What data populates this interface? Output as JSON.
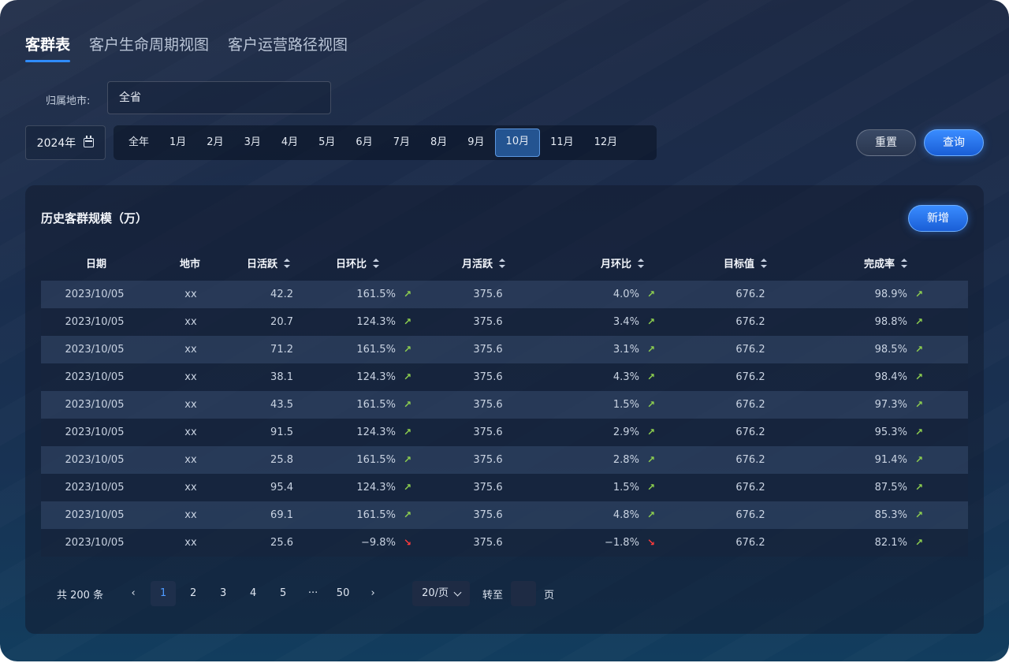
{
  "tabs": [
    {
      "label": "客群表",
      "active": true
    },
    {
      "label": "客户生命周期视图",
      "active": false
    },
    {
      "label": "客户运营路径视图",
      "active": false
    }
  ],
  "filter": {
    "city_label": "归属地市:",
    "city_value": "全省",
    "year_value": "2024年",
    "months": [
      "全年",
      "1月",
      "2月",
      "3月",
      "4月",
      "5月",
      "6月",
      "7月",
      "8月",
      "9月",
      "10月",
      "11月",
      "12月"
    ],
    "active_month": "10月",
    "reset_label": "重置",
    "query_label": "查询"
  },
  "card": {
    "title": "历史客群规模（万）",
    "add_label": "新增"
  },
  "table": {
    "headers": [
      "日期",
      "地市",
      "日活跃",
      "日环比",
      "月活跃",
      "月环比",
      "目标值",
      "完成率"
    ],
    "rows": [
      {
        "date": "2023/10/05",
        "city": "xx",
        "dau": "42.2",
        "dod": "161.5%",
        "dod_dir": "up",
        "mau": "375.6",
        "mom": "4.0%",
        "mom_dir": "up",
        "target": "676.2",
        "rate": "98.9%",
        "rate_dir": "up"
      },
      {
        "date": "2023/10/05",
        "city": "xx",
        "dau": "20.7",
        "dod": "124.3%",
        "dod_dir": "up",
        "mau": "375.6",
        "mom": "3.4%",
        "mom_dir": "up",
        "target": "676.2",
        "rate": "98.8%",
        "rate_dir": "up"
      },
      {
        "date": "2023/10/05",
        "city": "xx",
        "dau": "71.2",
        "dod": "161.5%",
        "dod_dir": "up",
        "mau": "375.6",
        "mom": "3.1%",
        "mom_dir": "up",
        "target": "676.2",
        "rate": "98.5%",
        "rate_dir": "up"
      },
      {
        "date": "2023/10/05",
        "city": "xx",
        "dau": "38.1",
        "dod": "124.3%",
        "dod_dir": "up",
        "mau": "375.6",
        "mom": "4.3%",
        "mom_dir": "up",
        "target": "676.2",
        "rate": "98.4%",
        "rate_dir": "up"
      },
      {
        "date": "2023/10/05",
        "city": "xx",
        "dau": "43.5",
        "dod": "161.5%",
        "dod_dir": "up",
        "mau": "375.6",
        "mom": "1.5%",
        "mom_dir": "up",
        "target": "676.2",
        "rate": "97.3%",
        "rate_dir": "up"
      },
      {
        "date": "2023/10/05",
        "city": "xx",
        "dau": "91.5",
        "dod": "124.3%",
        "dod_dir": "up",
        "mau": "375.6",
        "mom": "2.9%",
        "mom_dir": "up",
        "target": "676.2",
        "rate": "95.3%",
        "rate_dir": "up"
      },
      {
        "date": "2023/10/05",
        "city": "xx",
        "dau": "25.8",
        "dod": "161.5%",
        "dod_dir": "up",
        "mau": "375.6",
        "mom": "2.8%",
        "mom_dir": "up",
        "target": "676.2",
        "rate": "91.4%",
        "rate_dir": "up"
      },
      {
        "date": "2023/10/05",
        "city": "xx",
        "dau": "95.4",
        "dod": "124.3%",
        "dod_dir": "up",
        "mau": "375.6",
        "mom": "1.5%",
        "mom_dir": "up",
        "target": "676.2",
        "rate": "87.5%",
        "rate_dir": "up"
      },
      {
        "date": "2023/10/05",
        "city": "xx",
        "dau": "69.1",
        "dod": "161.5%",
        "dod_dir": "up",
        "mau": "375.6",
        "mom": "4.8%",
        "mom_dir": "up",
        "target": "676.2",
        "rate": "85.3%",
        "rate_dir": "up"
      },
      {
        "date": "2023/10/05",
        "city": "xx",
        "dau": "25.6",
        "dod": "−9.8%",
        "dod_dir": "down",
        "mau": "375.6",
        "mom": "−1.8%",
        "mom_dir": "down",
        "target": "676.2",
        "rate": "82.1%",
        "rate_dir": "up"
      }
    ]
  },
  "pagination": {
    "total": "共 200 条",
    "prev": "‹",
    "pages": [
      "1",
      "2",
      "3",
      "4",
      "5",
      "···",
      "50"
    ],
    "active_page": "1",
    "next": "›",
    "page_size": "20/页",
    "goto_label": "转至",
    "goto_unit": "页"
  },
  "colors": {
    "accent": "#2f8cff",
    "up": "#8fd14f",
    "down": "#ff3b3b"
  },
  "icons": {
    "calendar": "calendar-icon",
    "trend_up": "arrow-up-right-icon",
    "trend_down": "arrow-down-right-icon",
    "sort": "sort-icon"
  }
}
